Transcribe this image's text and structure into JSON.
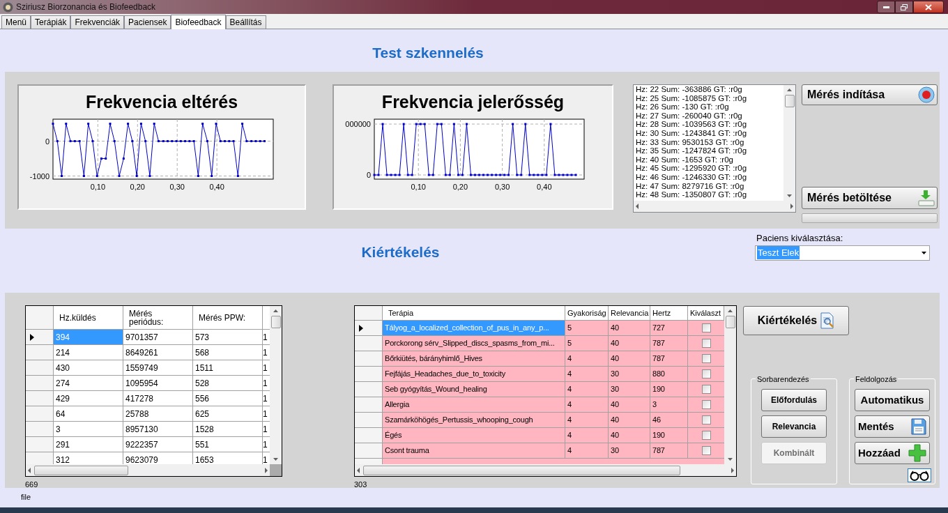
{
  "window": {
    "title": "Sziriusz Biorzonancia és Biofeedback"
  },
  "tabs": [
    {
      "label": "Menü",
      "selected": false
    },
    {
      "label": "Terápiák",
      "selected": false
    },
    {
      "label": "Frekvenciák",
      "selected": false
    },
    {
      "label": "Paciensek",
      "selected": false
    },
    {
      "label": "Biofeedback",
      "selected": true
    },
    {
      "label": "Beállítás",
      "selected": false
    }
  ],
  "scan": {
    "heading": "Test szkennelés",
    "charts": [
      {
        "title": "Frekvencia eltérés",
        "chart_data": {
          "type": "line",
          "grid": true,
          "xlim": [
            -0.013,
            0.542
          ],
          "ylim": [
            -1090,
            630
          ],
          "xticks": [
            {
              "value": 0.1,
              "label": "0,10"
            },
            {
              "value": 0.2,
              "label": "0,20"
            },
            {
              "value": 0.3,
              "label": "0,30"
            },
            {
              "value": 0.4,
              "label": "0,40"
            }
          ],
          "yticks": [
            {
              "value": 0,
              "label": "0"
            },
            {
              "value": -1000,
              "label": "-1000"
            }
          ],
          "x": [
            -0.013,
            -0.002,
            0.009,
            0.02,
            0.031,
            0.042,
            0.054,
            0.065,
            0.076,
            0.087,
            0.098,
            0.109,
            0.12,
            0.131,
            0.142,
            0.154,
            0.165,
            0.176,
            0.187,
            0.198,
            0.209,
            0.22,
            0.231,
            0.242,
            0.253,
            0.265,
            0.276,
            0.287,
            0.298,
            0.309,
            0.32,
            0.331,
            0.342,
            0.353,
            0.364,
            0.376,
            0.387,
            0.398,
            0.409,
            0.42,
            0.431,
            0.442,
            0.453,
            0.464,
            0.475,
            0.487,
            0.498,
            0.509,
            0.52
          ],
          "series": [
            {
              "color": "#0000c8",
              "marker": true,
              "values": [
                500,
                0,
                -1000,
                500,
                0,
                0,
                0,
                -1000,
                500,
                0,
                -1000,
                -500,
                -500,
                500,
                0,
                -1000,
                -500,
                500,
                0,
                -1000,
                500,
                0,
                -1000,
                500,
                0,
                0,
                0,
                0,
                0,
                0,
                0,
                0,
                0,
                -1000,
                500,
                0,
                -1000,
                500,
                0,
                0,
                0,
                0,
                -1000,
                500,
                0,
                0,
                0,
                0,
                0
              ]
            }
          ]
        }
      },
      {
        "title": "Frekvencia jelerősség",
        "kind": "picture",
        "x_tick_labels": [
          "0,10",
          "0,20",
          "0,30",
          "0,40"
        ],
        "y_tick_labels": [
          "000000",
          "0"
        ]
      }
    ],
    "log": [
      "Hz: 22 Sum: -363886 GT: :r0g",
      "Hz: 25 Sum: -1085875 GT: :r0g",
      "Hz: 26 Sum: -130 GT: :r0g",
      "Hz: 27 Sum: -260040 GT: :r0g",
      "Hz: 28 Sum: -1039563 GT: :r0g",
      "Hz: 30 Sum: -1243841 GT: :r0g",
      "Hz: 33 Sum: 9530153 GT: :r0g",
      "Hz: 35 Sum: -1247824 GT: :r0g",
      "Hz: 40 Sum: -1653 GT: :r0g",
      "Hz: 45 Sum: -1295920 GT: :r0g",
      "Hz: 46 Sum: -1246330 GT: :r0g",
      "Hz: 47 Sum: 8279716 GT: :r0g",
      "Hz: 48 Sum: -1350807 GT: :r0g"
    ],
    "start_button": "Mérés indítása",
    "load_button": "Mérés betöltése",
    "progress": {
      "level": 0
    }
  },
  "evaluation": {
    "heading": "Kiértékelés",
    "patient_label": "Paciens kiválasztása:",
    "patient_value": "Teszt Elek",
    "measurements": {
      "columns": [
        "Hz.küldés",
        "Mérés periódus:",
        "Mérés PPW:"
      ],
      "rows": [
        {
          "cells": [
            "394",
            "9701357",
            "573",
            "1"
          ],
          "selected": true
        },
        {
          "cells": [
            "214",
            "8649261",
            "568",
            "1"
          ],
          "selected": false
        },
        {
          "cells": [
            "430",
            "1559749",
            "1511",
            "1"
          ],
          "selected": false
        },
        {
          "cells": [
            "274",
            "1095954",
            "528",
            "1"
          ],
          "selected": false
        },
        {
          "cells": [
            "429",
            "417278",
            "556",
            "1"
          ],
          "selected": false
        },
        {
          "cells": [
            "64",
            "25788",
            "625",
            "1"
          ],
          "selected": false
        },
        {
          "cells": [
            "3",
            "8957130",
            "1528",
            "1"
          ],
          "selected": false
        },
        {
          "cells": [
            "291",
            "9222357",
            "551",
            "1"
          ],
          "selected": false
        },
        {
          "cells": [
            "312",
            "9623079",
            "1653",
            "1"
          ],
          "selected": false
        }
      ],
      "count": "669"
    },
    "therapies": {
      "columns": [
        "Terápia",
        "Gyakoriság",
        "Relevancia",
        "Hertz",
        "Kiválaszt"
      ],
      "rows": [
        {
          "cells": [
            "Tályog_a_localized_collection_of_pus_in_any_p...",
            "5",
            "40",
            "727"
          ],
          "checked": false,
          "selected": true
        },
        {
          "cells": [
            "Porckorong sérv_Slipped_discs_spasms_from_mi...",
            "5",
            "40",
            "787"
          ],
          "checked": false,
          "selected": false
        },
        {
          "cells": [
            "Bőrkiütés, bárányhimlő_Hives",
            "4",
            "40",
            "787"
          ],
          "checked": false,
          "selected": false
        },
        {
          "cells": [
            "Fejfájás_Headaches_due_to_toxicity",
            "4",
            "30",
            "880"
          ],
          "checked": false,
          "selected": false
        },
        {
          "cells": [
            "Seb gyógyítás_Wound_healing",
            "4",
            "30",
            "190"
          ],
          "checked": false,
          "selected": false
        },
        {
          "cells": [
            "Allergia",
            "4",
            "40",
            "3"
          ],
          "checked": false,
          "selected": false
        },
        {
          "cells": [
            "Szamárköhögés_Pertussis_whooping_cough",
            "4",
            "40",
            "46"
          ],
          "checked": false,
          "selected": false
        },
        {
          "cells": [
            "Égés",
            "4",
            "40",
            "190"
          ],
          "checked": false,
          "selected": false
        },
        {
          "cells": [
            "Csont trauma",
            "4",
            "30",
            "787"
          ],
          "checked": false,
          "selected": false
        }
      ],
      "count": "303"
    },
    "evaluate_button": "Kiértékelés",
    "sorting": {
      "title": "Sorbarendezés",
      "buttons": [
        {
          "label": "Előfordulás",
          "disabled": false
        },
        {
          "label": "Relevancia",
          "disabled": false
        },
        {
          "label": "Kombinált",
          "disabled": true
        }
      ]
    },
    "processing": {
      "title": "Feldolgozás",
      "buttons": [
        {
          "label": "Automatikus",
          "kind": "plain"
        },
        {
          "label": "Mentés",
          "kind": "save"
        },
        {
          "label": "Hozzáad",
          "kind": "add"
        }
      ]
    }
  },
  "status": "file"
}
